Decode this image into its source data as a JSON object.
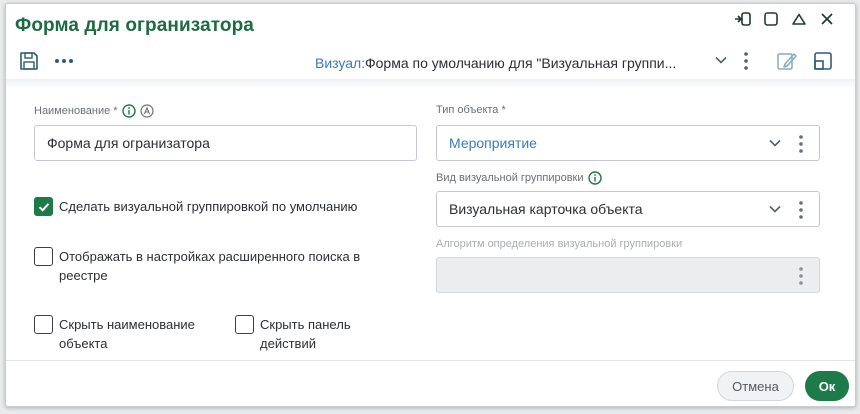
{
  "window": {
    "title": "Форма для огранизатора"
  },
  "window_controls": [
    "restore-down",
    "maximize",
    "collapse",
    "close"
  ],
  "toolbar": {
    "visual_label": "Визуал:",
    "visual_value": "Форма по умолчанию для \"Визуальная группи..."
  },
  "form": {
    "name_label": "Наименование *",
    "name_value": "Форма для огранизатора",
    "object_type_label": "Тип объекта *",
    "object_type_value": "Мероприятие",
    "visual_group_kind_label": "Вид визуальной группировки",
    "visual_group_kind_value": "Визуальная карточка объекта",
    "algorithm_label": "Алгоритм определения визуальной группировки",
    "algorithm_value": "",
    "checkbox_default": {
      "label": "Сделать визуальной группировкой по умолчанию",
      "checked": true
    },
    "checkbox_extended_search": {
      "label": "Отображать в настройках расширенного поиска в реестре",
      "checked": false
    },
    "checkbox_hide_name": {
      "label": "Скрыть наименование объекта",
      "checked": false
    },
    "checkbox_hide_actions": {
      "label": "Скрыть панель действий",
      "checked": false
    }
  },
  "buttons": {
    "cancel": "Отмена",
    "ok": "Ок"
  },
  "colors": {
    "accent_green": "#1d7a49",
    "title_green": "#1d6b43",
    "link_blue": "#3a7bc0"
  }
}
